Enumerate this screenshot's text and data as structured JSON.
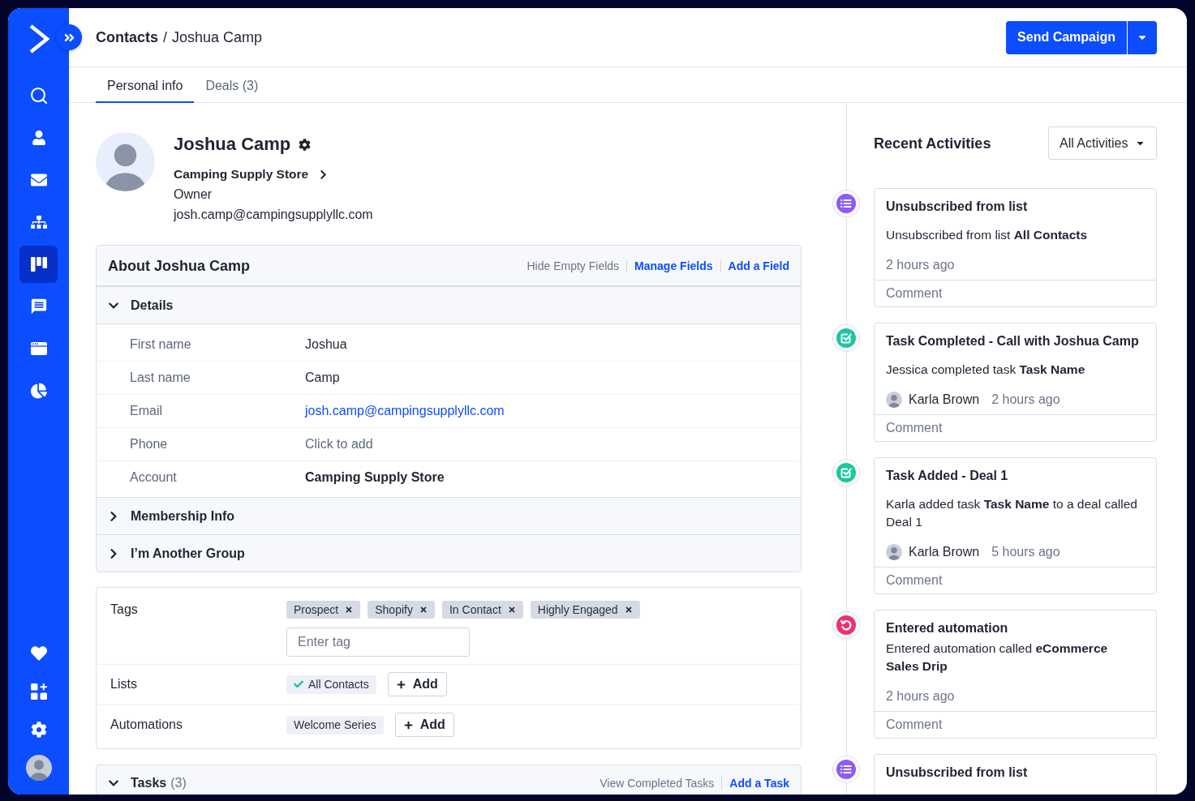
{
  "sidebar": {
    "nav": [
      {
        "selected": false
      },
      {
        "selected": false
      },
      {
        "selected": false
      },
      {
        "selected": false
      },
      {
        "selected": true
      },
      {
        "selected": false
      },
      {
        "selected": false
      },
      {
        "selected": false
      }
    ]
  },
  "header": {
    "breadcrumb": {
      "items": [
        "Contacts",
        "Joshua Camp"
      ],
      "separator": "/"
    },
    "primary_button": {
      "label": "Send Campaign"
    }
  },
  "tabs": [
    {
      "label": "Personal info",
      "selected": true
    },
    {
      "label": "Deals (3)",
      "selected": false
    }
  ],
  "profile": {
    "name": "Joshua Camp",
    "account": "Camping Supply Store",
    "role": "Owner",
    "email": "josh.camp@campingsupplyllc.com"
  },
  "about": {
    "title": "About Joshua Camp",
    "links": [
      {
        "label": "Hide Empty Fields",
        "kind": "muted"
      },
      {
        "label": "Manage Fields",
        "kind": "primary"
      },
      {
        "label": "Add a Field",
        "kind": "primary"
      }
    ],
    "groups": [
      {
        "label": "Details",
        "expanded": true,
        "fields": [
          {
            "label": "First name",
            "value": "Joshua",
            "kind": "text"
          },
          {
            "label": "Last name",
            "value": "Camp",
            "kind": "text"
          },
          {
            "label": "Email",
            "value": "josh.camp@campingsupplyllc.com",
            "kind": "link"
          },
          {
            "label": "Phone",
            "value": "Click to add",
            "kind": "placeholder"
          },
          {
            "label": "Account",
            "value": "Camping Supply Store",
            "kind": "strong"
          }
        ]
      },
      {
        "label": "Membership Info",
        "expanded": false
      },
      {
        "label": "I’m Another Group",
        "expanded": false
      }
    ]
  },
  "tags_panel": {
    "rows": [
      {
        "kind": "tags",
        "label": "Tags",
        "chips": [
          {
            "label": "Prospect"
          },
          {
            "label": "Shopify"
          },
          {
            "label": "In Contact"
          },
          {
            "label": "Highly Engaged"
          }
        ],
        "input": {
          "placeholder": "Enter tag"
        }
      },
      {
        "kind": "chips",
        "label": "Lists",
        "chips": [
          {
            "label": "All Contacts",
            "checked": true
          }
        ],
        "button": "Add"
      },
      {
        "kind": "chips",
        "label": "Automations",
        "chips": [
          {
            "label": "Welcome Series",
            "checked": false
          }
        ],
        "button": "Add"
      }
    ]
  },
  "tasks": {
    "title": "Tasks",
    "count": "(3)",
    "expanded": true,
    "links": [
      {
        "label": "View Completed Tasks",
        "kind": "muted"
      },
      {
        "label": "Add a Task",
        "kind": "primary"
      }
    ]
  },
  "activities": {
    "title": "Recent Activities",
    "filter": "All Activities",
    "items": [
      {
        "kind": "list",
        "title": "Unsubscribed from list",
        "body": "Unsubscribed from list **All Contacts**",
        "time": "2 hours ago",
        "comment": {
          "placeholder": "Comment"
        }
      },
      {
        "kind": "task",
        "title": "Task Completed - Call with Joshua Camp",
        "body": "Jessica completed task **Task Name**",
        "user": "Karla Brown",
        "time": "2 hours ago",
        "comment": {
          "placeholder": "Comment"
        }
      },
      {
        "kind": "task",
        "title": "Task Added - Deal 1",
        "body": "Karla added task **Task Name** to a deal called Deal 1",
        "user": "Karla Brown",
        "time": "5 hours ago",
        "comment": {
          "placeholder": "Comment"
        }
      },
      {
        "kind": "automation",
        "title": "Entered automation",
        "body": "Entered automation called **eCommerce Sales Drip**",
        "time": "2 hours ago",
        "comment": {
          "placeholder": "Comment"
        }
      },
      {
        "kind": "list",
        "title": "Unsubscribed from list"
      }
    ]
  }
}
